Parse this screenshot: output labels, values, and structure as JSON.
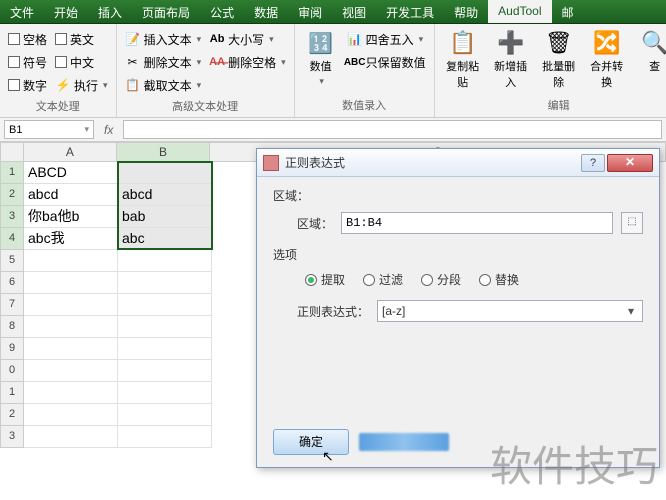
{
  "tabs": [
    "文件",
    "开始",
    "插入",
    "页面布局",
    "公式",
    "数据",
    "审阅",
    "视图",
    "开发工具",
    "帮助",
    "AudTool",
    "邮"
  ],
  "activeTab": 10,
  "ribbon": {
    "g1": {
      "items": [
        [
          "空格",
          "英文"
        ],
        [
          "符号",
          "中文"
        ],
        [
          "数字",
          "执行"
        ]
      ],
      "arrows": [
        false,
        false,
        false,
        false,
        false,
        true
      ],
      "label": "文本处理"
    },
    "g2": {
      "items": [
        "插入文本",
        "删除文本",
        "截取文本",
        "大小写",
        "删除空格"
      ],
      "label": "高级文本处理"
    },
    "g3": {
      "big": "数值",
      "items": [
        "四舍五入",
        "只保留数值"
      ],
      "label": "数值录入"
    },
    "g4": {
      "items": [
        "复制粘贴",
        "新增插入",
        "批量删除",
        "合并转换",
        "查"
      ],
      "label": "编辑"
    }
  },
  "namebox": "B1",
  "columns": [
    "A",
    "B",
    "C"
  ],
  "rows": [
    "1",
    "2",
    "3",
    "4",
    "5",
    "6",
    "7",
    "8",
    "9",
    "0",
    "1",
    "2",
    "3"
  ],
  "cells": {
    "A1": "ABCD",
    "B1": "",
    "A2": "abcd",
    "B2": "abcd",
    "A3": "你ba他b",
    "B3": "bab",
    "A4": "abc我",
    "B4": "abc"
  },
  "dialog": {
    "title": "正则表达式",
    "section_region": "区域：",
    "label_region": "区域：",
    "region_value": "B1:B4",
    "section_options": "选项",
    "radios": [
      "提取",
      "过滤",
      "分段",
      "替换"
    ],
    "radio_selected": 0,
    "label_regex": "正则表达式：",
    "regex_value": "[a-z]",
    "ok": "确定"
  },
  "watermark": "软件技巧"
}
